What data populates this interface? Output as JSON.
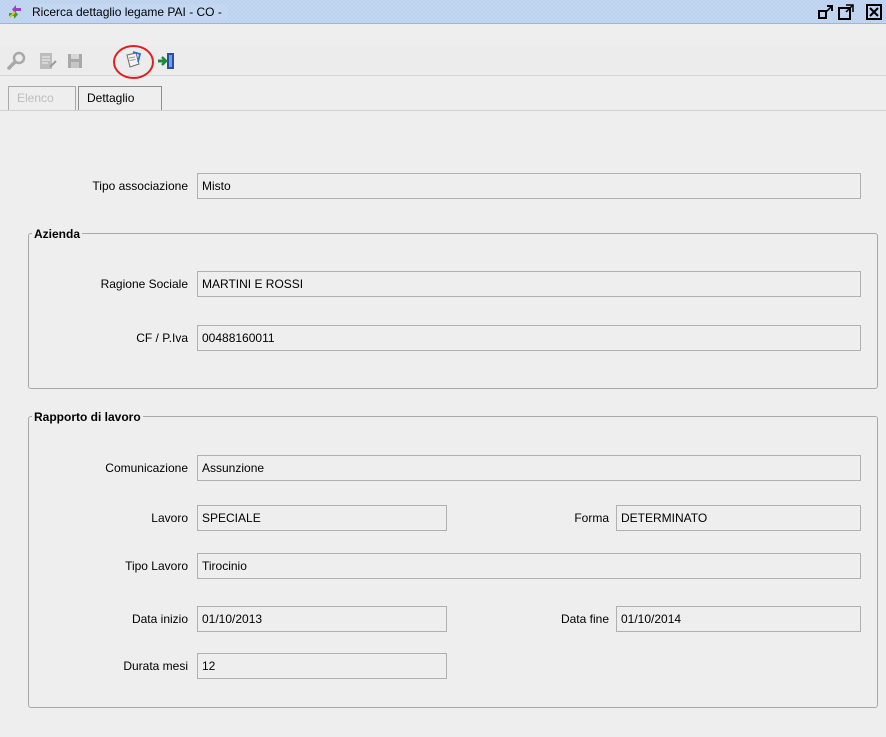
{
  "window": {
    "title": "Ricerca dettaglio legame PAI - CO -"
  },
  "toolbar": {
    "buttons": [
      {
        "name": "search",
        "icon": "magnifier-icon",
        "enabled": false
      },
      {
        "name": "edit",
        "icon": "edit-document-icon",
        "enabled": false
      },
      {
        "name": "save",
        "icon": "floppy-disk-icon",
        "enabled": false
      },
      {
        "name": "export",
        "icon": "document-export-icon",
        "enabled": true,
        "highlighted": true
      },
      {
        "name": "exit",
        "icon": "exit-icon",
        "enabled": true
      }
    ],
    "highlight_color": "#e02020"
  },
  "tabs": [
    {
      "label": "Elenco",
      "active": false
    },
    {
      "label": "Dettaglio",
      "active": true
    }
  ],
  "form": {
    "tipo_associazione": {
      "label": "Tipo associazione",
      "value": "Misto"
    }
  },
  "azienda": {
    "title": "Azienda",
    "ragione_sociale": {
      "label": "Ragione Sociale",
      "value": "MARTINI E ROSSI"
    },
    "cf_piva": {
      "label": "CF / P.Iva",
      "value": "00488160011"
    }
  },
  "rapporto": {
    "title": "Rapporto di lavoro",
    "comunicazione": {
      "label": "Comunicazione",
      "value": "Assunzione"
    },
    "lavoro": {
      "label": "Lavoro",
      "value": "SPECIALE"
    },
    "forma": {
      "label": "Forma",
      "value": "DETERMINATO"
    },
    "tipo_lavoro": {
      "label": "Tipo Lavoro",
      "value": "Tirocinio"
    },
    "data_inizio": {
      "label": "Data inizio",
      "value": "01/10/2013"
    },
    "data_fine": {
      "label": "Data fine",
      "value": "01/10/2014"
    },
    "durata_mesi": {
      "label": "Durata mesi",
      "value": "12"
    }
  }
}
